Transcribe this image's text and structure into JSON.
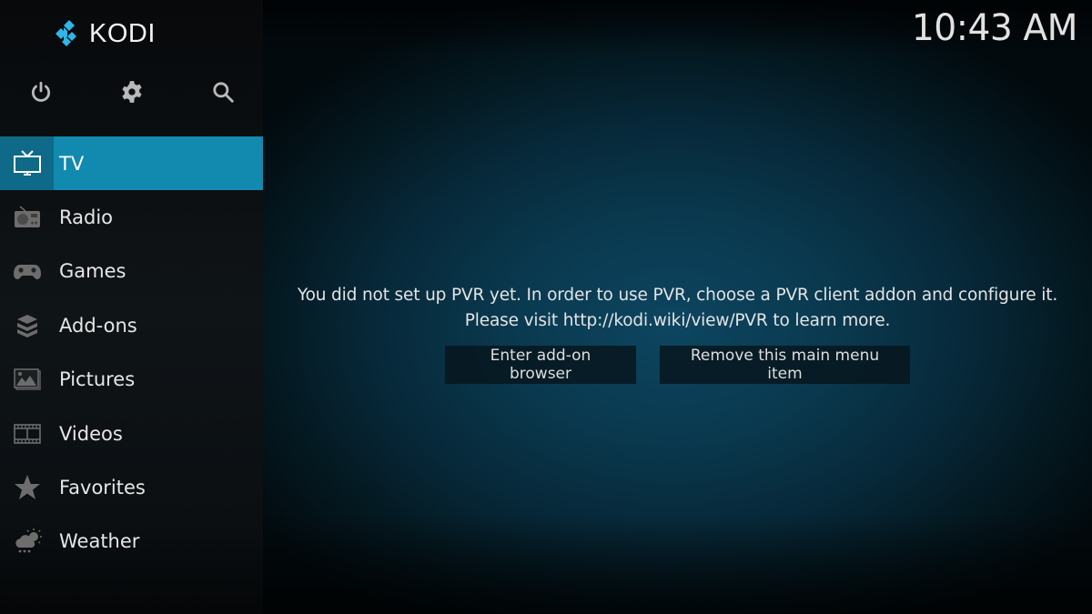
{
  "app": {
    "name": "KODI",
    "accent_color": "#1289ae",
    "accent_dark_color": "#0e6a88",
    "logo_color": "#2fb5e6"
  },
  "header": {
    "clock": "10:43 AM"
  },
  "top_icons": [
    {
      "name": "power-icon",
      "label": "Power"
    },
    {
      "name": "gear-icon",
      "label": "Settings"
    },
    {
      "name": "search-icon",
      "label": "Search"
    }
  ],
  "sidebar": {
    "items": [
      {
        "label": "TV",
        "icon": "tv-icon",
        "active": true
      },
      {
        "label": "Radio",
        "icon": "radio-icon",
        "active": false
      },
      {
        "label": "Games",
        "icon": "gamepad-icon",
        "active": false
      },
      {
        "label": "Add-ons",
        "icon": "box-icon",
        "active": false
      },
      {
        "label": "Pictures",
        "icon": "picture-icon",
        "active": false
      },
      {
        "label": "Videos",
        "icon": "film-icon",
        "active": false
      },
      {
        "label": "Favorites",
        "icon": "star-icon",
        "active": false
      },
      {
        "label": "Weather",
        "icon": "weather-icon",
        "active": false
      }
    ]
  },
  "main": {
    "message_line1": "You did not set up PVR yet. In order to use PVR, choose a PVR client addon and configure it.",
    "message_line2": "Please visit http://kodi.wiki/view/PVR to learn more.",
    "buttons": {
      "enter_addon_browser": "Enter add-on browser",
      "remove_menu_item": "Remove this main menu item"
    }
  }
}
